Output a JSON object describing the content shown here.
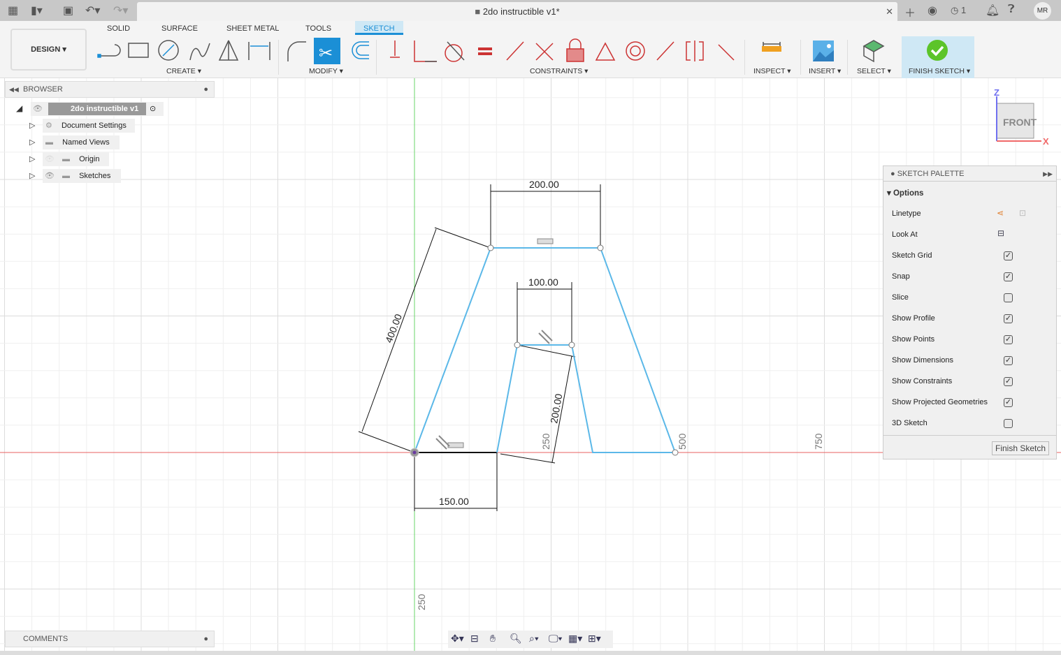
{
  "app": {
    "document_title": "2do instructible v1*",
    "user_initials": "MR",
    "jobs_count": "1"
  },
  "ribbon": {
    "workspace": "DESIGN",
    "tabs": [
      "SOLID",
      "SURFACE",
      "SHEET METAL",
      "TOOLS",
      "SKETCH"
    ],
    "active_tab": "SKETCH",
    "groups": {
      "create": "CREATE",
      "modify": "MODIFY",
      "constraints": "CONSTRAINTS",
      "inspect": "INSPECT",
      "insert": "INSERT",
      "select": "SELECT",
      "finish": "FINISH SKETCH"
    }
  },
  "browser": {
    "title": "BROWSER",
    "root": "2do instructible v1",
    "items": [
      "Document Settings",
      "Named Views",
      "Origin",
      "Sketches"
    ]
  },
  "comments": {
    "title": "COMMENTS"
  },
  "viewcube": {
    "face": "FRONT",
    "axis_z": "Z",
    "axis_x": "X"
  },
  "palette": {
    "title": "SKETCH PALETTE",
    "section": "Options",
    "options": [
      {
        "label": "Linetype",
        "type": "icons"
      },
      {
        "label": "Look At",
        "type": "icon"
      },
      {
        "label": "Sketch Grid",
        "checked": true
      },
      {
        "label": "Snap",
        "checked": true
      },
      {
        "label": "Slice",
        "checked": false
      },
      {
        "label": "Show Profile",
        "checked": true
      },
      {
        "label": "Show Points",
        "checked": true
      },
      {
        "label": "Show Dimensions",
        "checked": true
      },
      {
        "label": "Show Constraints",
        "checked": true
      },
      {
        "label": "Show Projected Geometries",
        "checked": true
      },
      {
        "label": "3D Sketch",
        "checked": false
      }
    ],
    "finish_button": "Finish Sketch"
  },
  "sketch": {
    "dimensions": {
      "top_width": "200.00",
      "inner_width": "100.00",
      "bottom_width": "150.00",
      "left_length": "400.00",
      "inner_length": "200.00"
    },
    "grid_labels": {
      "x250": "250",
      "x500": "500",
      "x750": "750",
      "y250": "250"
    },
    "colors": {
      "profile": "#5bb8e8",
      "x_axis": "#e86060",
      "y_axis": "#6ad46a",
      "dimension": "#111111",
      "accent": "#1b8fd6"
    }
  }
}
